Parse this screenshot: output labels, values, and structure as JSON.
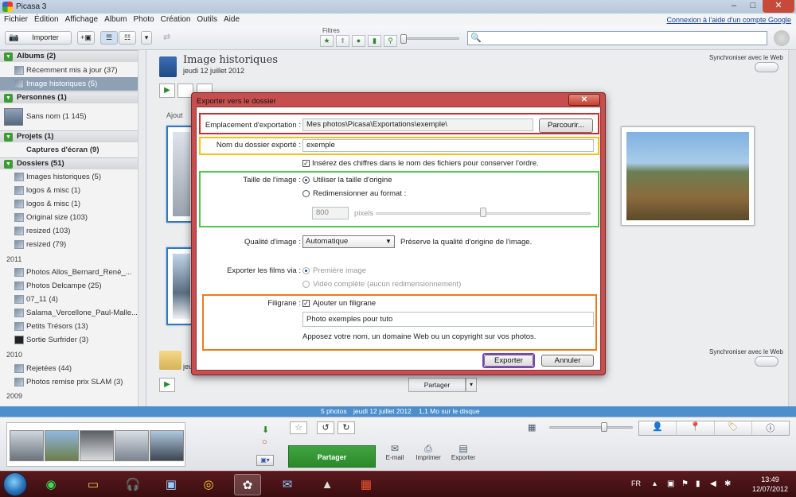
{
  "window": {
    "title": "Picasa 3",
    "controls": [
      "–",
      "□",
      "✕"
    ]
  },
  "menu": {
    "items": [
      "Fichier",
      "Édition",
      "Affichage",
      "Album",
      "Photo",
      "Création",
      "Outils",
      "Aide"
    ],
    "signin": "Connexion à l'aide d'un compte Google"
  },
  "toolbar": {
    "import_label": "Importer",
    "filters_label": "Filtres"
  },
  "sidebar": {
    "albums": {
      "header": "Albums (2)",
      "items": [
        {
          "label": "Récemment mis à jour (37)"
        },
        {
          "label": "Image historiques (5)"
        }
      ]
    },
    "people": {
      "header": "Personnes (1)",
      "items": [
        {
          "label": "Sans nom (1 145)"
        }
      ]
    },
    "projects": {
      "header": "Projets (1)",
      "items": [
        {
          "label": "Captures d'écran (9)"
        }
      ]
    },
    "folders": {
      "header": "Dossiers (51)",
      "items": [
        "Images historiques (5)",
        "logos & misc (1)",
        "logos & misc (1)",
        "Original size (103)",
        "resized (103)",
        "resized (79)"
      ]
    },
    "y2011": {
      "label": "2011",
      "items": [
        "Photos Allos_Bernard_René_...",
        "Photos Delcampe (25)",
        "07_11 (4)",
        "Salama_Vercellone_Paul-Malle...",
        "Petits Trésors (13)",
        "Sortie Surfrider (3)"
      ]
    },
    "y2010": {
      "label": "2010",
      "items": [
        "Rejetées (44)",
        "Photos remise prix  SLAM (3)"
      ]
    },
    "y2009": {
      "label": "2009"
    }
  },
  "main": {
    "album_title": "Image historiques",
    "album_date": "jeudi 12 juillet 2012",
    "sync_label": "Synchroniser avec le Web",
    "add_label": "Ajout",
    "share_label": "Partager",
    "album2_date": "jeu"
  },
  "dialog": {
    "title": "Exporter vers le dossier",
    "close": "✕",
    "location_label": "Emplacement d'exportation :",
    "location_value": "Mes photos\\Picasa\\Exportations\\exemple\\",
    "browse_label": "Parcourir...",
    "folder_name_label": "Nom du dossier exporté :",
    "folder_name_value": "exemple",
    "insert_numbers_label": "Insérez des chiffres dans le nom des fichiers pour conserver l'ordre.",
    "image_size_label": "Taille de l'image :",
    "use_original_label": "Utiliser la taille d'origine",
    "resize_label": "Redimensionner au format :",
    "resize_value": "800",
    "pixels_label": "pixels",
    "quality_label": "Qualité d'image :",
    "quality_value": "Automatique",
    "quality_desc": "Préserve la qualité d'origine de l'image.",
    "movies_label": "Exporter les films via :",
    "movies_first": "Première image",
    "movies_full": "Vidéo complète (aucun redimensionnement)",
    "watermark_label": "Filigrane :",
    "watermark_check": "Ajouter un filigrane",
    "watermark_value": "Photo exemples pour tuto",
    "watermark_desc": "Apposez votre nom, un domaine Web ou un copyright sur vos photos.",
    "export_btn": "Exporter",
    "cancel_btn": "Annuler",
    "highlight_colors": {
      "location": "#d42a2a",
      "folder": "#f2c21a",
      "size": "#4cc94a",
      "watermark": "#f07a1a",
      "export": "#7a3fc2"
    }
  },
  "status": {
    "photos": "5 photos",
    "date": "jeudi 12 juillet 2012",
    "size": "1,1 Mo sur le disque"
  },
  "bottom": {
    "share_label": "Partager",
    "email_label": "E-mail",
    "print_label": "Imprimer",
    "export_label": "Exporter"
  },
  "taskbar": {
    "lang": "FR",
    "time": "13:49",
    "date": "12/07/2012"
  }
}
